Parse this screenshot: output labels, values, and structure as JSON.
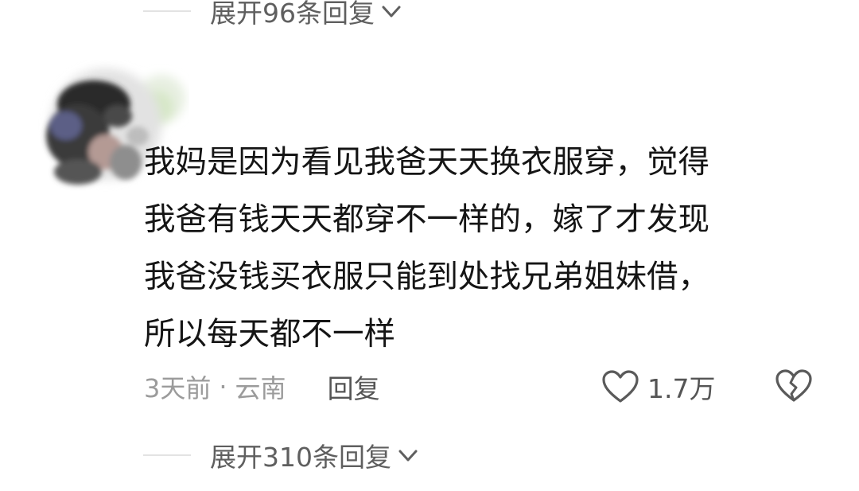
{
  "replies_top": {
    "label": "展开96条回复"
  },
  "comment": {
    "lines": [
      "我妈是因为看见我爸天天换衣服穿，觉得",
      "我爸有钱天天都穿不一样的，嫁了才发现",
      "我爸没钱买衣服只能到处找兄弟姐妹借，",
      "所以每天都不一样"
    ],
    "time": "3天前",
    "separator": "·",
    "location": "云南",
    "reply_label": "回复",
    "like_count": "1.7万"
  },
  "replies_bottom": {
    "label": "展开310条回复"
  },
  "icons": {
    "expand": "chevron-down-icon",
    "like": "heart-outline-icon",
    "dislike": "broken-heart-icon"
  },
  "colors": {
    "text_primary": "#151515",
    "text_meta": "#9b9b9b",
    "text_action": "#555555",
    "divider": "#e3e3e3"
  }
}
